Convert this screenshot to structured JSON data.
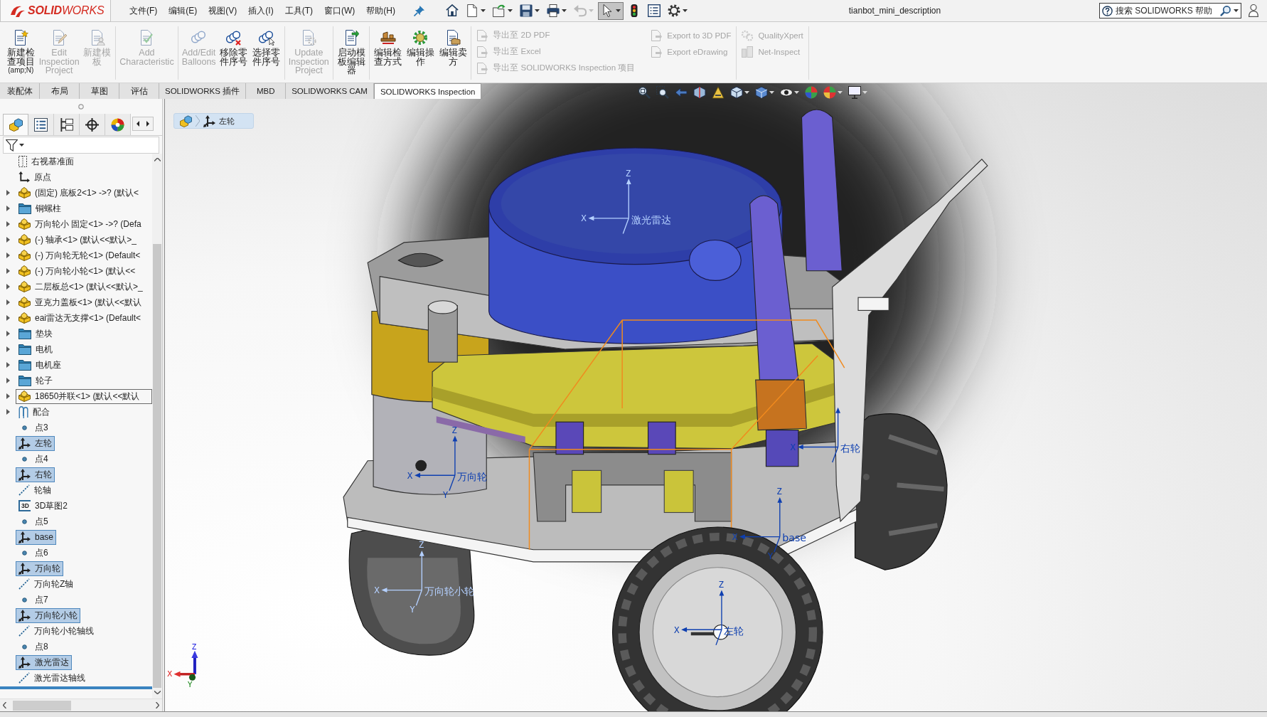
{
  "title_bar": {
    "logo": "**SOLID**WORKS",
    "menus": [
      "文件(F)",
      "编辑(E)",
      "视图(V)",
      "插入(I)",
      "工具(T)",
      "窗口(W)",
      "帮助(H)"
    ],
    "quick_access": [
      {
        "kind": "home",
        "dropdown": false,
        "pressed": false,
        "disabled": false
      },
      {
        "kind": "new",
        "dropdown": true,
        "pressed": false,
        "disabled": false
      },
      {
        "kind": "open",
        "dropdown": true,
        "pressed": false,
        "disabled": false
      },
      {
        "kind": "save",
        "dropdown": true,
        "pressed": false,
        "disabled": false
      },
      {
        "kind": "print",
        "dropdown": true,
        "pressed": false,
        "disabled": false
      },
      {
        "kind": "undo",
        "dropdown": true,
        "pressed": false,
        "disabled": true
      },
      {
        "kind": "select",
        "dropdown": true,
        "pressed": true,
        "disabled": false
      },
      {
        "kind": "rebuild",
        "dropdown": false,
        "pressed": false,
        "disabled": false
      },
      {
        "kind": "properties",
        "dropdown": false,
        "pressed": false,
        "disabled": false
      },
      {
        "kind": "options",
        "dropdown": true,
        "pressed": false,
        "disabled": false
      }
    ],
    "document_title": "tianbot_mini_description",
    "search": {
      "placeholder": "搜索 SOLIDWORKS 帮助"
    }
  },
  "ribbon": {
    "groups": [
      {
        "items": [
          {
            "kind": "large",
            "label": "新建检查项目",
            "shortcut": "(amp;N)",
            "disabled": false
          },
          {
            "kind": "large",
            "label": "Edit Inspection Project",
            "disabled": true
          },
          {
            "kind": "large",
            "label": "新建模板",
            "disabled": true
          }
        ]
      },
      {
        "items": [
          {
            "kind": "large",
            "label": "Add Characteristic",
            "disabled": true
          }
        ]
      },
      {
        "items": [
          {
            "kind": "large",
            "label": "Add/Edit Balloons",
            "disabled": true
          },
          {
            "kind": "large",
            "label": "移除零件序号",
            "disabled": false
          },
          {
            "kind": "large",
            "label": "选择零件序号",
            "disabled": false
          }
        ]
      },
      {
        "items": [
          {
            "kind": "large",
            "label": "Update Inspection Project",
            "disabled": true
          }
        ]
      },
      {
        "items": [
          {
            "kind": "large",
            "label": "启动模板编辑器",
            "disabled": false
          }
        ]
      },
      {
        "items": [
          {
            "kind": "large",
            "label": "编辑检查方式",
            "disabled": false
          },
          {
            "kind": "large",
            "label": "编辑操作",
            "disabled": false
          },
          {
            "kind": "large",
            "label": "编辑卖方",
            "disabled": false
          }
        ]
      },
      {
        "items": [
          {
            "kind": "small",
            "label": "导出至 2D PDF",
            "disabled": true
          },
          {
            "kind": "small",
            "label": "导出至 Excel",
            "disabled": true
          },
          {
            "kind": "small",
            "label": "导出至 SOLIDWORKS Inspection 项目",
            "disabled": true
          },
          {
            "kind": "small",
            "label": "Export to 3D PDF",
            "disabled": true
          },
          {
            "kind": "small",
            "label": "Export eDrawing",
            "disabled": true
          }
        ]
      },
      {
        "items": [
          {
            "kind": "small",
            "label": "QualityXpert",
            "disabled": true
          },
          {
            "kind": "small",
            "label": "Net-Inspect",
            "disabled": true
          }
        ]
      }
    ]
  },
  "command_tabs": [
    {
      "label": "装配体",
      "selected": false
    },
    {
      "label": "布局",
      "selected": false
    },
    {
      "label": "草图",
      "selected": false
    },
    {
      "label": "评估",
      "selected": false
    },
    {
      "label": "SOLIDWORKS 插件",
      "selected": false
    },
    {
      "label": "MBD",
      "selected": false
    },
    {
      "label": "SOLIDWORKS CAM",
      "selected": false
    },
    {
      "label": "SOLIDWORKS Inspection",
      "selected": true
    }
  ],
  "feature_manager": {
    "tabs": [
      {
        "kind": "feature-tree",
        "selected": true
      },
      {
        "kind": "property",
        "selected": false
      },
      {
        "kind": "configuration",
        "selected": false
      },
      {
        "kind": "dimxpert",
        "selected": false
      },
      {
        "kind": "display",
        "selected": false
      }
    ],
    "items": [
      {
        "kind": "plane",
        "label": "右视基准面",
        "expandable": false,
        "selected": false,
        "focused": false
      },
      {
        "kind": "origin",
        "label": "原点",
        "expandable": false,
        "selected": false,
        "focused": false
      },
      {
        "kind": "part",
        "label": "(固定) 底板2<1> ->? (默认<",
        "expandable": true,
        "selected": false,
        "focused": false
      },
      {
        "kind": "folder",
        "label": "铜螺柱",
        "expandable": true,
        "selected": false,
        "focused": false
      },
      {
        "kind": "part",
        "label": "万向轮小 固定<1> ->? (Defa",
        "expandable": true,
        "selected": false,
        "focused": false
      },
      {
        "kind": "part",
        "label": "(-) 轴承<1> (默认<<默认>_",
        "expandable": true,
        "selected": false,
        "focused": false
      },
      {
        "kind": "part",
        "label": "(-) 万向轮无轮<1> (Default<",
        "expandable": true,
        "selected": false,
        "focused": false
      },
      {
        "kind": "part",
        "label": "(-) 万向轮小轮<1> (默认<<",
        "expandable": true,
        "selected": false,
        "focused": false
      },
      {
        "kind": "part",
        "label": "二层板总<1> (默认<<默认>_",
        "expandable": true,
        "selected": false,
        "focused": false
      },
      {
        "kind": "part",
        "label": "亚克力盖板<1> (默认<<默认",
        "expandable": true,
        "selected": false,
        "focused": false
      },
      {
        "kind": "part",
        "label": "eai雷达无支撑<1> (Default<",
        "expandable": true,
        "selected": false,
        "focused": false
      },
      {
        "kind": "folder",
        "label": "垫块",
        "expandable": true,
        "selected": false,
        "focused": false
      },
      {
        "kind": "folder",
        "label": "电机",
        "expandable": true,
        "selected": false,
        "focused": false
      },
      {
        "kind": "folder",
        "label": "电机座",
        "expandable": true,
        "selected": false,
        "focused": false
      },
      {
        "kind": "folder",
        "label": "轮子",
        "expandable": true,
        "selected": false,
        "focused": false
      },
      {
        "kind": "part",
        "label": "18650并联<1> (默认<<默认",
        "expandable": true,
        "selected": false,
        "focused": true
      },
      {
        "kind": "mates",
        "label": "配合",
        "expandable": true,
        "selected": false,
        "focused": false
      },
      {
        "kind": "point",
        "label": "点3",
        "expandable": false,
        "selected": false,
        "focused": false
      },
      {
        "kind": "coordsys",
        "label": "左轮",
        "expandable": false,
        "selected": true,
        "focused": false
      },
      {
        "kind": "point",
        "label": "点4",
        "expandable": false,
        "selected": false,
        "focused": false
      },
      {
        "kind": "coordsys",
        "label": "右轮",
        "expandable": false,
        "selected": true,
        "focused": false
      },
      {
        "kind": "axis",
        "label": "轮轴",
        "expandable": false,
        "selected": false,
        "focused": false
      },
      {
        "kind": "sketch3d",
        "badge": "3D",
        "label": "3D草图2",
        "expandable": false,
        "selected": false,
        "focused": false
      },
      {
        "kind": "point",
        "label": "点5",
        "expandable": false,
        "selected": false,
        "focused": false
      },
      {
        "kind": "coordsys",
        "label": "base",
        "expandable": false,
        "selected": true,
        "focused": false
      },
      {
        "kind": "point",
        "label": "点6",
        "expandable": false,
        "selected": false,
        "focused": false
      },
      {
        "kind": "coordsys",
        "label": "万向轮",
        "expandable": false,
        "selected": true,
        "focused": false
      },
      {
        "kind": "axis",
        "label": "万向轮Z轴",
        "expandable": false,
        "selected": false,
        "focused": false
      },
      {
        "kind": "point",
        "label": "点7",
        "expandable": false,
        "selected": false,
        "focused": false
      },
      {
        "kind": "coordsys",
        "label": "万向轮小轮",
        "expandable": false,
        "selected": true,
        "focused": false
      },
      {
        "kind": "axis",
        "label": "万向轮小轮轴线",
        "expandable": false,
        "selected": false,
        "focused": false
      },
      {
        "kind": "point",
        "label": "点8",
        "expandable": false,
        "selected": false,
        "focused": false
      },
      {
        "kind": "coordsys",
        "label": "激光雷达",
        "expandable": false,
        "selected": true,
        "focused": false
      },
      {
        "kind": "axis",
        "label": "激光雷达轴线",
        "expandable": false,
        "selected": false,
        "focused": false
      }
    ]
  },
  "viewport": {
    "breadcrumb": {
      "label": "左轮"
    },
    "frames": [
      {
        "label": "激光雷达",
        "axes": {
          "z": "Z",
          "x": "X"
        }
      },
      {
        "label": "万向轮",
        "axes": {
          "z": "Z",
          "x": "X",
          "y": "Y"
        }
      },
      {
        "label": "万向轮小轮",
        "axes": {
          "z": "Z",
          "x": "X",
          "y": "Y"
        }
      },
      {
        "label": "base",
        "axes": {
          "z": "Z",
          "x": "X",
          "y": "Y"
        }
      },
      {
        "label": "右轮",
        "axes": {
          "x": "X"
        }
      },
      {
        "label": "左轮",
        "axes": {
          "z": "Z",
          "x": "X"
        }
      }
    ],
    "triad": {
      "x": "X",
      "y": "Y",
      "z": "Z"
    }
  }
}
